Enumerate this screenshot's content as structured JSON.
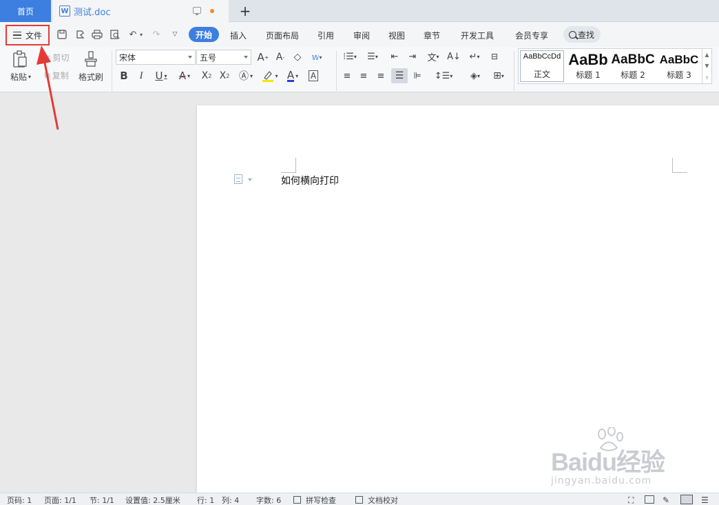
{
  "tabs": {
    "home": "首页",
    "document": "测试.doc"
  },
  "menu": {
    "file": "文件",
    "tabs": [
      "开始",
      "插入",
      "页面布局",
      "引用",
      "审阅",
      "视图",
      "章节",
      "开发工具",
      "会员专享"
    ],
    "search": "查找"
  },
  "ribbon": {
    "paste": "粘贴",
    "cut": "剪切",
    "copy": "复制",
    "format_painter": "格式刷",
    "font_name": "宋体",
    "font_size": "五号"
  },
  "styles": [
    {
      "preview": "AaBbCcDd",
      "label": "正文"
    },
    {
      "preview": "AaBb",
      "label": "标题 1"
    },
    {
      "preview": "AaBbC",
      "label": "标题 2"
    },
    {
      "preview": "AaBbC",
      "label": "标题 3"
    }
  ],
  "document": {
    "text": "如何横向打印"
  },
  "statusbar": {
    "page": "页码: 1",
    "pages": "页面: 1/1",
    "section": "节: 1/1",
    "setting": "设置值: 2.5厘米",
    "row": "行: 1",
    "col": "列: 4",
    "words": "字数: 6",
    "spellcheck": "拼写检查",
    "proofread": "文档校对"
  },
  "watermark": {
    "brand": "Baidu经验",
    "url": "jingyan.baidu.com"
  },
  "colors": {
    "accent": "#3d7fe0",
    "highlight_box": "#e53935",
    "unsaved_dot": "#f28b2a"
  }
}
